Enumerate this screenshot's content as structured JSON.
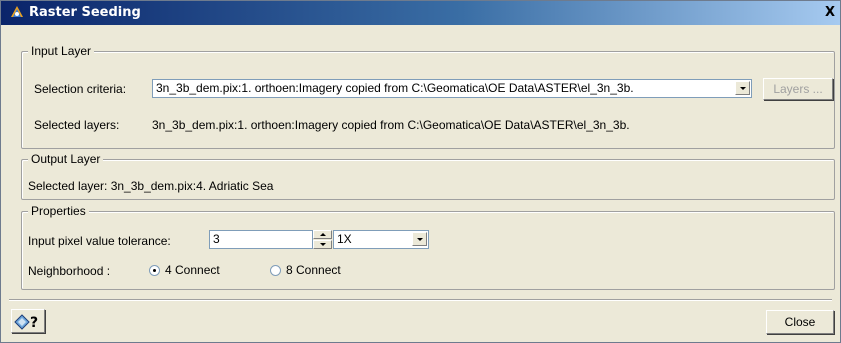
{
  "window": {
    "title": "Raster Seeding",
    "close_glyph": "X",
    "icon": "geomatica-app-icon"
  },
  "input_layer": {
    "group_label": "Input Layer",
    "selection_criteria_label": "Selection criteria:",
    "selection_criteria_value": "3n_3b_dem.pix:1. orthoen:Imagery copied from C:\\Geomatica\\OE Data\\ASTER\\el_3n_3b.",
    "layers_button": "Layers ...",
    "selected_layers_label": "Selected layers:",
    "selected_layers_value": "3n_3b_dem.pix:1. orthoen:Imagery copied from C:\\Geomatica\\OE Data\\ASTER\\el_3n_3b."
  },
  "output_layer": {
    "group_label": "Output Layer",
    "selected_layer_text": "Selected layer: 3n_3b_dem.pix:4. Adriatic Sea"
  },
  "properties": {
    "group_label": "Properties",
    "tolerance_label": "Input pixel value tolerance:",
    "tolerance_value": "3",
    "multiplier_value": "1X",
    "neighborhood_label": "Neighborhood :",
    "option_4": "4 Connect",
    "option_8": "8 Connect",
    "selected_option": "4 Connect"
  },
  "footer": {
    "help_icon": "help-book-icon",
    "close_button": "Close"
  }
}
